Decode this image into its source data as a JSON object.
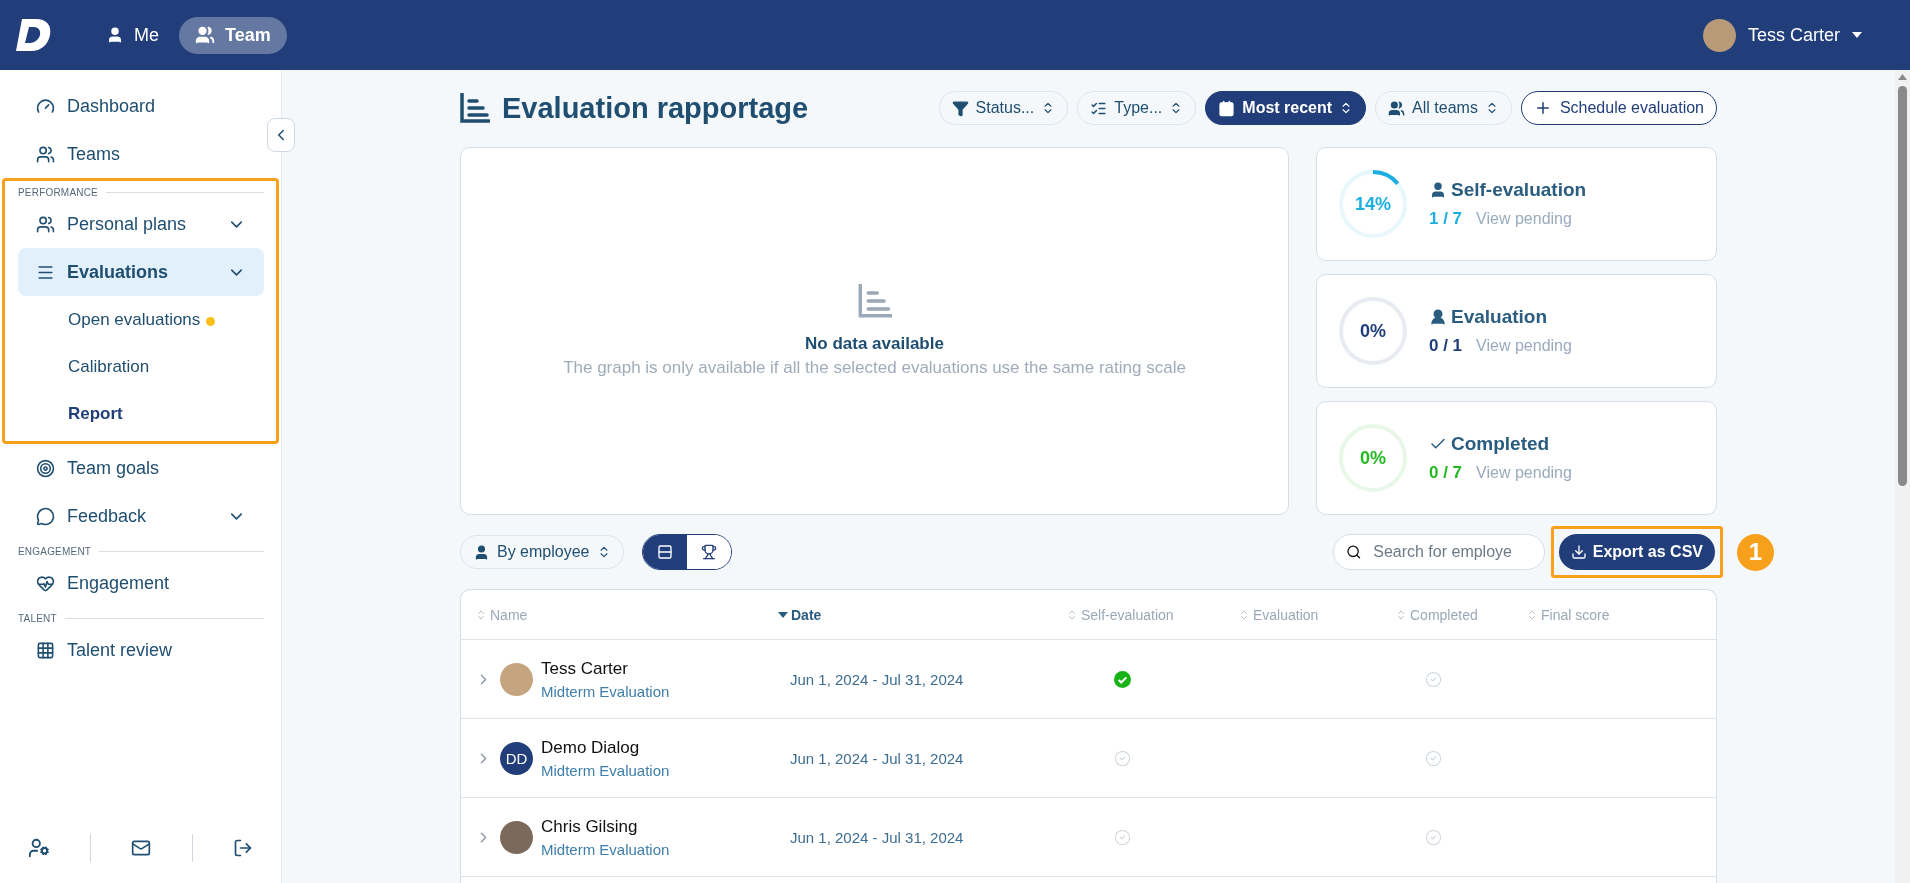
{
  "topbar": {
    "nav": [
      {
        "label": "Me",
        "selected": false
      },
      {
        "label": "Team",
        "selected": true
      }
    ],
    "user": {
      "name": "Tess Carter"
    }
  },
  "sidebar": {
    "groups": [
      {
        "items": [
          {
            "label": "Dashboard",
            "selected": false
          },
          {
            "label": "Teams",
            "selected": false
          }
        ]
      },
      {
        "heading": "PERFORMANCE",
        "highlighted": true,
        "items": [
          {
            "label": "Personal plans",
            "selected": false,
            "submenu": true
          },
          {
            "label": "Evaluations",
            "selected": true,
            "submenu": true,
            "children": [
              {
                "label": "Open evaluations",
                "selected": false,
                "unread": true
              },
              {
                "label": "Calibration",
                "selected": false,
                "unread": false
              },
              {
                "label": "Report",
                "selected": true,
                "unread": false
              }
            ]
          }
        ]
      },
      {
        "items": [
          {
            "label": "Team goals",
            "selected": false
          },
          {
            "label": "Feedback",
            "selected": false,
            "submenu": true
          }
        ]
      },
      {
        "heading": "ENGAGEMENT",
        "items": [
          {
            "label": "Engagement",
            "selected": false
          }
        ]
      },
      {
        "heading": "TALENT",
        "items": [
          {
            "label": "Talent review",
            "selected": false
          }
        ]
      }
    ]
  },
  "page": {
    "title": "Evaluation rapportage",
    "filters": [
      {
        "label": "Status...",
        "selected": false
      },
      {
        "label": "Type...",
        "selected": false
      },
      {
        "label": "Most recent",
        "selected": true
      },
      {
        "label": "All teams",
        "selected": false
      }
    ],
    "schedule_button": "Schedule evaluation"
  },
  "chart_panel": {
    "title": "No data available",
    "message": "The graph is only available if all the selected evaluations use the same rating scale"
  },
  "stats": [
    {
      "title": "Self-evaluation",
      "percent": "14%",
      "count": "1 / 7",
      "link": "View pending",
      "level": 0.14,
      "color": "#1cb0e2"
    },
    {
      "title": "Evaluation",
      "percent": "0%",
      "count": "0 / 1",
      "link": "View pending",
      "level": 0,
      "color": "#213e7a"
    },
    {
      "title": "Completed",
      "percent": "0%",
      "count": "0 / 7",
      "link": "View pending",
      "level": 0,
      "color": "#22b922"
    }
  ],
  "toolbar": {
    "group_by": "By employee",
    "views": [
      {
        "selected": true
      },
      {
        "selected": false
      }
    ],
    "search": {
      "placeholder": "Search for employe"
    },
    "export_button": "Export as CSV",
    "export_highlighted": true,
    "annotation": "1"
  },
  "table": {
    "columns": [
      {
        "label": "Name",
        "sorted": false
      },
      {
        "label": "Date",
        "sorted": true
      },
      {
        "label": "Self-evaluation",
        "sorted": false
      },
      {
        "label": "Evaluation",
        "sorted": false
      },
      {
        "label": "Completed",
        "sorted": false
      },
      {
        "label": "Final score",
        "sorted": false
      }
    ],
    "rows": [
      {
        "name": "Tess Carter",
        "evaluation": "Midterm Evaluation",
        "period": "Jun 1, 2024 - Jul 31, 2024",
        "self_evaluation_done": true,
        "completed_done": false
      },
      {
        "name": "Demo Dialog",
        "evaluation": "Midterm Evaluation",
        "period": "Jun 1, 2024 - Jul 31, 2024",
        "initials": "DD",
        "self_evaluation_done": false,
        "completed_done": false
      },
      {
        "name": "Chris Gilsing",
        "evaluation": "Midterm Evaluation",
        "period": "Jun 1, 2024 - Jul 31, 2024",
        "self_evaluation_done": false,
        "completed_done": false
      }
    ]
  }
}
